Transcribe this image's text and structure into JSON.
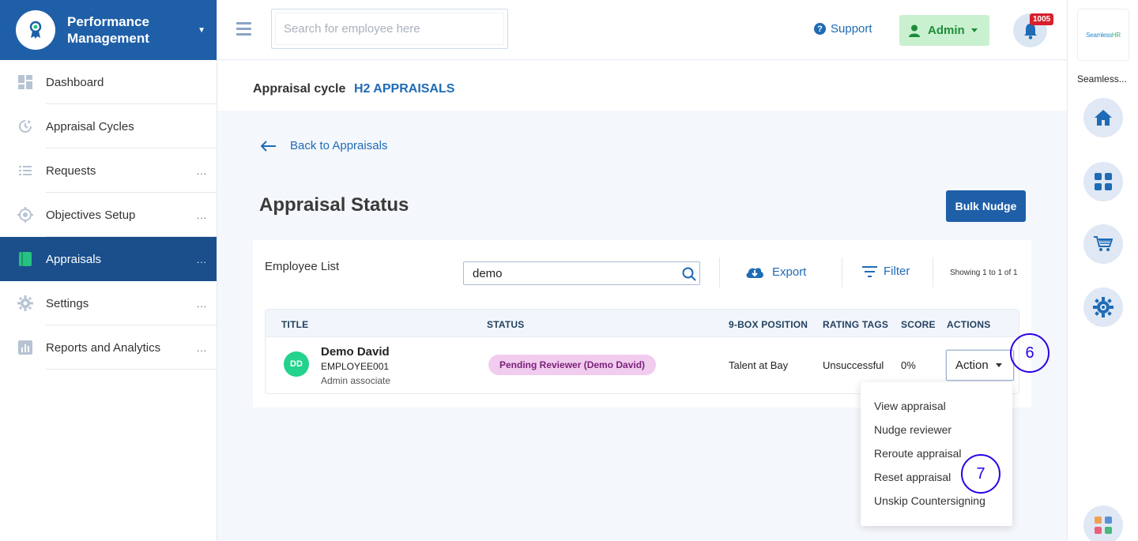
{
  "sidebar": {
    "brand_title": "Performance Management",
    "items": [
      {
        "label": "Dashboard",
        "dots": ""
      },
      {
        "label": "Appraisal Cycles",
        "dots": ""
      },
      {
        "label": "Requests",
        "dots": "..."
      },
      {
        "label": "Objectives Setup",
        "dots": "..."
      },
      {
        "label": "Appraisals",
        "dots": "..."
      },
      {
        "label": "Settings",
        "dots": "..."
      },
      {
        "label": "Reports and Analytics",
        "dots": "..."
      }
    ],
    "active_index": 4
  },
  "header": {
    "search_placeholder": "Search for employee here",
    "support_label": "Support",
    "admin_label": "Admin",
    "notification_count": "1005"
  },
  "rail": {
    "logo_text_a": "Seamless",
    "logo_text_b": "HR",
    "label": "Seamless..."
  },
  "cycle": {
    "label": "Appraisal cycle",
    "value": "H2 APPRAISALS"
  },
  "main": {
    "back_label": "Back to Appraisals",
    "title": "Appraisal Status",
    "bulk_nudge_label": "Bulk Nudge",
    "employee_list_label": "Employee List",
    "search_value": "demo",
    "export_label": "Export",
    "filter_label": "Filter",
    "showing_text": "Showing 1 to 1 of 1"
  },
  "table": {
    "headers": [
      "TITLE",
      "STATUS",
      "9-BOX POSITION",
      "RATING TAGS",
      "SCORE",
      "ACTIONS"
    ],
    "rows": [
      {
        "initials": "DD",
        "name": "Demo David",
        "code": "EMPLOYEE001",
        "role": "Admin associate",
        "status": "Pending Reviewer (Demo David)",
        "nine_box": "Talent at Bay",
        "rating_tag": "Unsuccessful",
        "score": "0%",
        "action_label": "Action"
      }
    ]
  },
  "dropdown": {
    "items": [
      "View appraisal",
      "Nudge reviewer",
      "Reroute appraisal",
      "Reset appraisal",
      "Unskip Countersigning"
    ]
  },
  "markers": [
    "6",
    "7"
  ],
  "colors": {
    "brand": "#1f5fa8",
    "active_nav": "#1a4f8b",
    "link": "#1f6bb5",
    "admin_bg": "#c9f1cf",
    "status_pill": "#f1ccef",
    "marker": "#2b00e8"
  }
}
